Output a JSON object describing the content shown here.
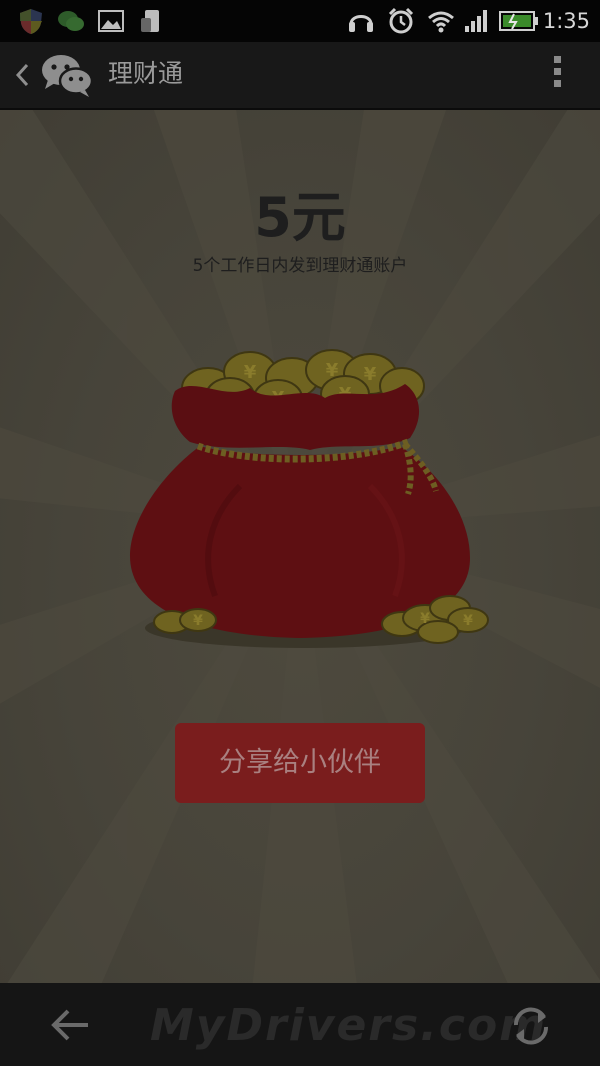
{
  "status_bar": {
    "time": "1:35",
    "icons": [
      "shield-icon",
      "wechat-notification-icon",
      "image-icon",
      "phone-icon",
      "headset-icon",
      "alarm-icon",
      "wifi-icon",
      "signal-icon",
      "battery-icon"
    ],
    "accent_colors": {
      "battery_green": "#3a8a2a"
    }
  },
  "action_bar": {
    "title": "理财通",
    "icons": [
      "back-chevron-icon",
      "wechat-logo-icon",
      "overflow-menu-icon"
    ]
  },
  "main": {
    "amount": "5元",
    "subtitle": "5个工作日内发到理财通账户",
    "illustration": "money-bag-with-coins",
    "share_button_label": "分享给小伙伴",
    "colors": {
      "background": "#47443a",
      "bag": "#5e0f12",
      "button": "#7a1d1d",
      "coin": "#6f6320"
    }
  },
  "bottom_nav": {
    "icons": [
      "back-arrow-icon",
      "refresh-icon"
    ],
    "watermark": "MyDrivers.com"
  }
}
